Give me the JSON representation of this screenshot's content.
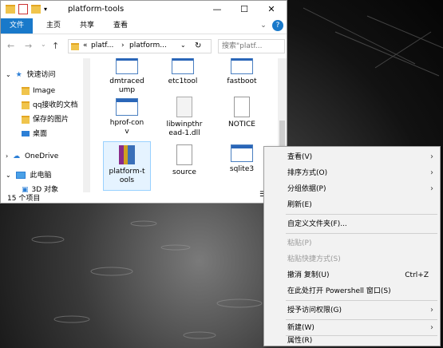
{
  "window": {
    "title": "platform-tools",
    "minimize_icon": "minimize-icon",
    "maximize_icon": "maximize-icon",
    "close_icon": "close-icon"
  },
  "ribbon": {
    "tabs": [
      "文件",
      "主页",
      "共享",
      "查看"
    ],
    "help": "?"
  },
  "address": {
    "crumbs": [
      "platf...",
      "platform..."
    ],
    "search_placeholder": "搜索\"platf..."
  },
  "sidebar": {
    "items": [
      "快速访问",
      "Image",
      "qq接收的文档",
      "保存的图片",
      "桌面",
      "OneDrive",
      "此电脑",
      "3D 对象"
    ]
  },
  "files": [
    {
      "name": "dmtraced\nump",
      "icon": "exe-icon"
    },
    {
      "name": "etc1tool",
      "icon": "exe-icon"
    },
    {
      "name": "fastboot",
      "icon": "exe-icon"
    },
    {
      "name": "hprof-con\nv",
      "icon": "exe-icon"
    },
    {
      "name": "libwinpthr\nead-1.dll",
      "icon": "dll-icon"
    },
    {
      "name": "NOTICE",
      "icon": "document-icon"
    },
    {
      "name": "platform-t\nools",
      "icon": "archive-icon"
    },
    {
      "name": "source",
      "icon": "text-icon"
    },
    {
      "name": "sqlite3",
      "icon": "exe-icon"
    }
  ],
  "status": {
    "count": "15 个项目"
  },
  "context_menu": {
    "items": [
      {
        "label": "查看(V)",
        "submenu": true
      },
      {
        "label": "排序方式(O)",
        "submenu": true
      },
      {
        "label": "分组依据(P)",
        "submenu": true
      },
      {
        "label": "刷新(E)"
      },
      {
        "label": "自定义文件夹(F)..."
      },
      {
        "label": "粘贴(P)",
        "disabled": true
      },
      {
        "label": "粘贴快捷方式(S)",
        "disabled": true
      },
      {
        "label": "撤消 复制(U)",
        "shortcut": "Ctrl+Z"
      },
      {
        "label": "在此处打开 Powershell 窗口(S)"
      },
      {
        "label": "授予访问权限(G)",
        "submenu": true
      },
      {
        "label": "新建(W)",
        "submenu": true
      },
      {
        "label": "属性(R)"
      }
    ]
  },
  "colors": {
    "file_tab": "#1979ca",
    "selection": "#e5f3ff",
    "menu_bg": "#f2f2f2"
  }
}
